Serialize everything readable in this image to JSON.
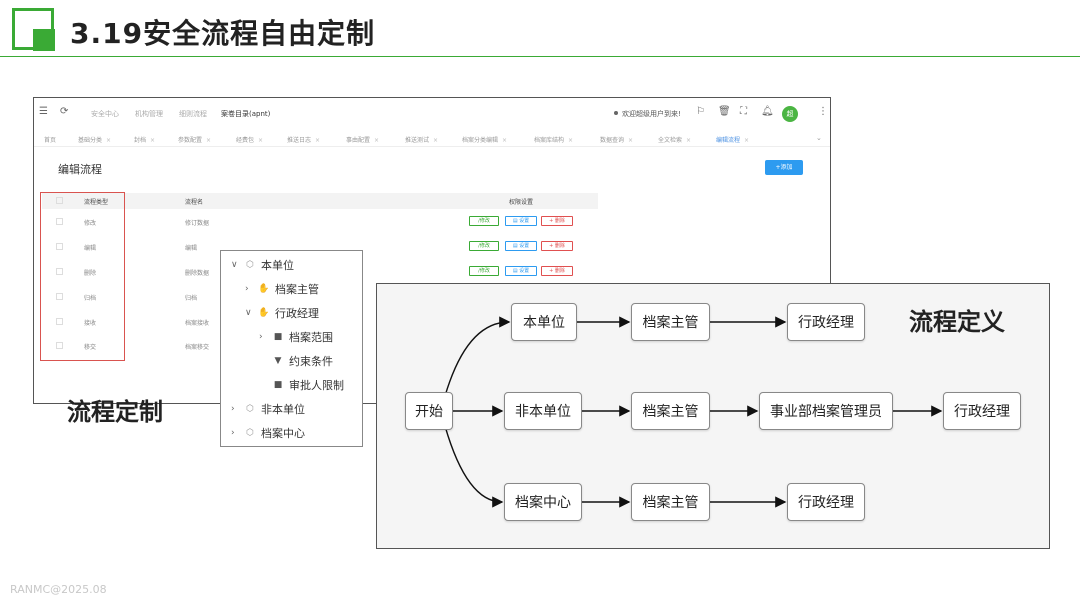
{
  "slide": {
    "title": "3.19安全流程自由定制",
    "caption_left": "流程定制",
    "footer": "RANMC@2025.08",
    "accent_color": "#3aaa35"
  },
  "app": {
    "nav": [
      "安全中心",
      "机构管理",
      "细则流程",
      "案卷目录(apnt)"
    ],
    "welcome": "欢迎超级用户到来!",
    "avatar_initial": "超",
    "tabs": [
      "首页",
      "基础分类",
      "封档",
      "参数配置",
      "经费包",
      "推送日志",
      "事由配置",
      "推送测试",
      "档案分类编辑",
      "档案库结构",
      "数据查询",
      "全文检索",
      "编辑流程"
    ],
    "active_tab": "编辑流程",
    "page_heading": "编辑流程",
    "add_button": "+添加",
    "table": {
      "headers": [
        "流程类型",
        "流程名",
        "权限设置"
      ],
      "rows": [
        {
          "type": "修改",
          "name": "修订数据"
        },
        {
          "type": "编辑",
          "name": "编辑"
        },
        {
          "type": "删除",
          "name": "删除数据"
        },
        {
          "type": "归档",
          "name": "归档"
        },
        {
          "type": "接收",
          "name": "档案接收"
        },
        {
          "type": "移交",
          "name": "档案移交"
        }
      ],
      "ops": {
        "edit": "∕修改",
        "set": "▤ 设置",
        "del": "+ 删除"
      }
    }
  },
  "tree": {
    "items": [
      {
        "label": "本单位",
        "chev": "∨",
        "icon": "⬡"
      },
      {
        "label": "档案主管",
        "chev": "›",
        "icon": "✋"
      },
      {
        "label": "行政经理",
        "chev": "∨",
        "icon": "✋"
      },
      {
        "label": "档案范围",
        "chev": "›",
        "icon": "■"
      },
      {
        "label": "约束条件",
        "chev": "",
        "icon": "▼"
      },
      {
        "label": "审批人限制",
        "chev": "",
        "icon": "■"
      },
      {
        "label": "非本单位",
        "chev": "›",
        "icon": "⬡"
      },
      {
        "label": "档案中心",
        "chev": "›",
        "icon": "⬡"
      }
    ]
  },
  "flow": {
    "title": "流程定义",
    "start": "开始",
    "paths": [
      [
        "本单位",
        "档案主管",
        "行政经理"
      ],
      [
        "非本单位",
        "档案主管",
        "事业部档案管理员",
        "行政经理"
      ],
      [
        "档案中心",
        "档案主管",
        "行政经理"
      ]
    ]
  }
}
